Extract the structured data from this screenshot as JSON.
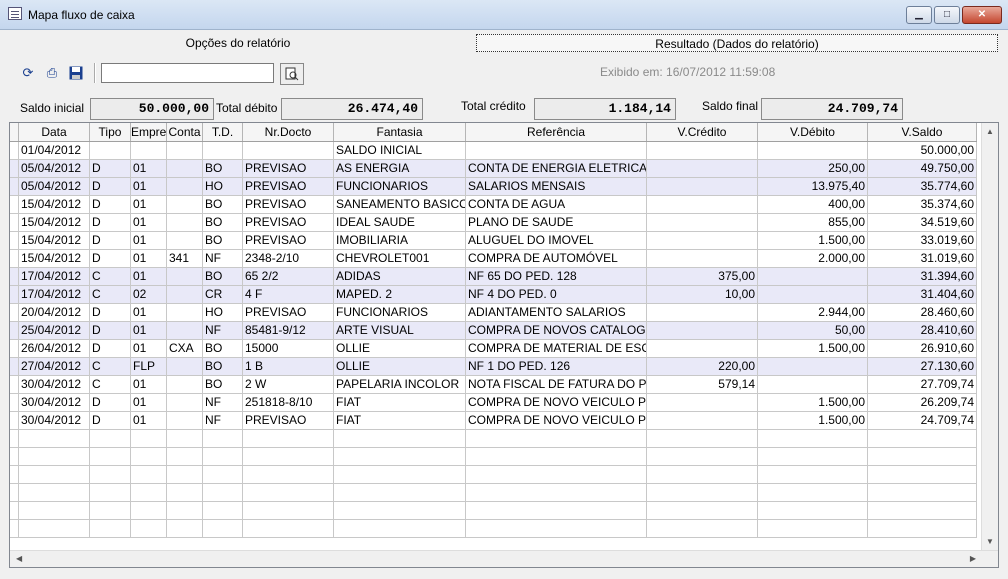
{
  "window": {
    "title": "Mapa fluxo de caixa",
    "btn_min": "▁",
    "btn_max": "□",
    "btn_close": "✕"
  },
  "tabs": [
    {
      "label": "Opções do relatório"
    },
    {
      "label": "Resultado (Dados do relatório)"
    }
  ],
  "toolbar": {
    "refresh_icon": "refresh-icon",
    "print_icon": "printer-icon",
    "save_icon": "floppy-icon",
    "search_value": "",
    "preview_icon": "print-preview-icon"
  },
  "exibido": "Exibido em: 16/07/2012 11:59:08",
  "summary": {
    "saldo_inicial_label": "Saldo inicial",
    "saldo_inicial": "50.000,00",
    "total_debito_label": "Total débito",
    "total_debito": "26.474,40",
    "total_credito_label": "Total crédito",
    "total_credito": "1.184,14",
    "saldo_final_label": "Saldo final",
    "saldo_final": "24.709,74"
  },
  "grid": {
    "columns": [
      "Data",
      "Tipo",
      "Empre",
      "Conta",
      "T.D.",
      "Nr.Docto",
      "Fantasia",
      "Referência",
      "V.Crédito",
      "V.Débito",
      "V.Saldo"
    ],
    "rows": [
      [
        "01/04/2012",
        "",
        "",
        "",
        "",
        "",
        "SALDO INICIAL",
        "",
        "",
        "",
        "50.000,00"
      ],
      [
        "05/04/2012",
        "D",
        "01",
        "",
        "BO",
        "PREVISAO",
        "AS ENERGIA",
        "CONTA DE ENERGIA ELETRICA",
        "",
        "250,00",
        "49.750,00"
      ],
      [
        "05/04/2012",
        "D",
        "01",
        "",
        "HO",
        "PREVISAO",
        "FUNCIONARIOS",
        "SALARIOS MENSAIS",
        "",
        "13.975,40",
        "35.774,60"
      ],
      [
        "15/04/2012",
        "D",
        "01",
        "",
        "BO",
        "PREVISAO",
        "SANEAMENTO BASICO",
        "CONTA DE AGUA",
        "",
        "400,00",
        "35.374,60"
      ],
      [
        "15/04/2012",
        "D",
        "01",
        "",
        "BO",
        "PREVISAO",
        "IDEAL SAUDE",
        "PLANO DE SAUDE",
        "",
        "855,00",
        "34.519,60"
      ],
      [
        "15/04/2012",
        "D",
        "01",
        "",
        "BO",
        "PREVISAO",
        "IMOBILIARIA",
        "ALUGUEL DO IMOVEL",
        "",
        "1.500,00",
        "33.019,60"
      ],
      [
        "15/04/2012",
        "D",
        "01",
        "341",
        "NF",
        "2348-2/10",
        "CHEVROLET001",
        "COMPRA DE AUTOMÓVEL",
        "",
        "2.000,00",
        "31.019,60"
      ],
      [
        "17/04/2012",
        "C",
        "01",
        "",
        "BO",
        "65 2/2",
        "ADIDAS",
        "NF 65 DO PED. 128",
        "375,00",
        "",
        "31.394,60"
      ],
      [
        "17/04/2012",
        "C",
        "02",
        "",
        "CR",
        "4 F",
        "MAPED. 2",
        "NF 4 DO PED. 0",
        "10,00",
        "",
        "31.404,60"
      ],
      [
        "20/04/2012",
        "D",
        "01",
        "",
        "HO",
        "PREVISAO",
        "FUNCIONARIOS",
        "ADIANTAMENTO SALARIOS",
        "",
        "2.944,00",
        "28.460,60"
      ],
      [
        "25/04/2012",
        "D",
        "01",
        "",
        "NF",
        "85481-9/12",
        "ARTE VISUAL",
        "COMPRA DE NOVOS CATALOGOS",
        "",
        "50,00",
        "28.410,60"
      ],
      [
        "26/04/2012",
        "D",
        "01",
        "CXA",
        "BO",
        "15000",
        "OLLIE",
        "COMPRA DE MATERIAL DE ESCRITORIO",
        "",
        "1.500,00",
        "26.910,60"
      ],
      [
        "27/04/2012",
        "C",
        "FLP",
        "",
        "BO",
        "1 B",
        "OLLIE",
        "NF 1 DO PED. 126",
        "220,00",
        "",
        "27.130,60"
      ],
      [
        "30/04/2012",
        "C",
        "01",
        "",
        "BO",
        "2 W",
        "PAPELARIA INCOLOR",
        "NOTA FISCAL DE FATURA DO PEDIDO",
        "579,14",
        "",
        "27.709,74"
      ],
      [
        "30/04/2012",
        "D",
        "01",
        "",
        "NF",
        "251818-8/10",
        "FIAT",
        "COMPRA DE NOVO VEICULO PLACA",
        "",
        "1.500,00",
        "26.209,74"
      ],
      [
        "30/04/2012",
        "D",
        "01",
        "",
        "NF",
        "PREVISAO",
        "FIAT",
        "COMPRA DE NOVO VEICULO PLACA",
        "",
        "1.500,00",
        "24.709,74"
      ]
    ],
    "highlighted_rows": [
      1,
      2,
      7,
      8,
      10,
      12
    ]
  }
}
